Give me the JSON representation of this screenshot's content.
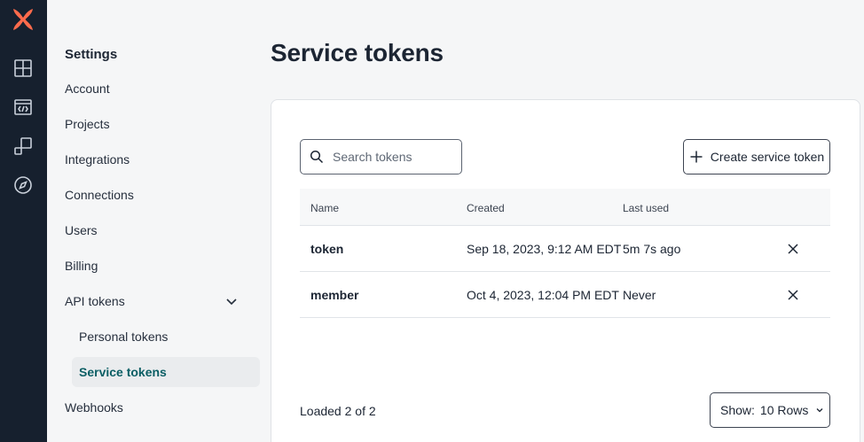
{
  "sidebar": {
    "title": "Settings",
    "items": [
      {
        "label": "Account"
      },
      {
        "label": "Projects"
      },
      {
        "label": "Integrations"
      },
      {
        "label": "Connections"
      },
      {
        "label": "Users"
      },
      {
        "label": "Billing"
      },
      {
        "label": "API tokens"
      },
      {
        "label": "Webhooks"
      }
    ],
    "api_tokens_sub": [
      {
        "label": "Personal tokens",
        "active": false
      },
      {
        "label": "Service tokens",
        "active": true
      }
    ]
  },
  "main": {
    "title": "Service tokens",
    "search": {
      "placeholder": "Search tokens",
      "value": ""
    },
    "create_button": "Create service token",
    "table": {
      "headers": {
        "name": "Name",
        "created": "Created",
        "last_used": "Last used"
      },
      "rows": [
        {
          "name": "token",
          "created": "Sep 18, 2023, 9:12 AM EDT",
          "last_used": "5m 7s ago"
        },
        {
          "name": "member",
          "created": "Oct 4, 2023, 12:04 PM EDT",
          "last_used": "Never"
        }
      ]
    },
    "footer": {
      "loaded": "Loaded 2 of 2",
      "show_label": "Show:",
      "show_value": "10 Rows"
    }
  },
  "colors": {
    "rail": "#16202e",
    "logo": "#fe6b4c",
    "active_text": "#0b5e64"
  }
}
